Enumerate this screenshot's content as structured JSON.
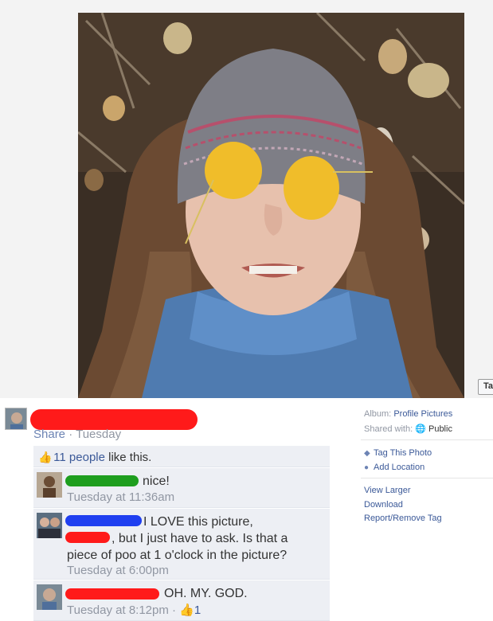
{
  "photo": {
    "tag_button_label": "Ta"
  },
  "post": {
    "owner_name": "",
    "share_label": "Share",
    "separator": " · ",
    "timestamp": "Tuesday"
  },
  "likes": {
    "count_text": "11 people",
    "suffix": " like this."
  },
  "comments": [
    {
      "author": "",
      "text": "nice!",
      "time": "Tuesday at 11:36am"
    },
    {
      "author": "",
      "text_line1": "I LOVE this picture,",
      "text_line2": ", but I just have to ask. Is that a",
      "text_line3": "piece of poo at 1 o'clock in the picture?",
      "time": "Tuesday at 6:00pm"
    },
    {
      "author": "",
      "text": "OH. MY. GOD.",
      "time": "Tuesday at 8:12pm · ",
      "likes": "1"
    }
  ],
  "sidebar": {
    "album_label": "Album:",
    "album_value": "Profile Pictures",
    "shared_label": "Shared with:",
    "shared_value": "Public",
    "tag_photo": "Tag This Photo",
    "add_location": "Add Location",
    "view_larger": "View Larger",
    "download": "Download",
    "report": "Report/Remove Tag"
  },
  "colors": {
    "link": "#3b5998",
    "meta_gray": "#9197a3",
    "comment_bg": "#edeff4",
    "redact_red": "#ff1a1a",
    "redact_green": "#1e9e1e",
    "redact_blue": "#1f3ff0"
  }
}
